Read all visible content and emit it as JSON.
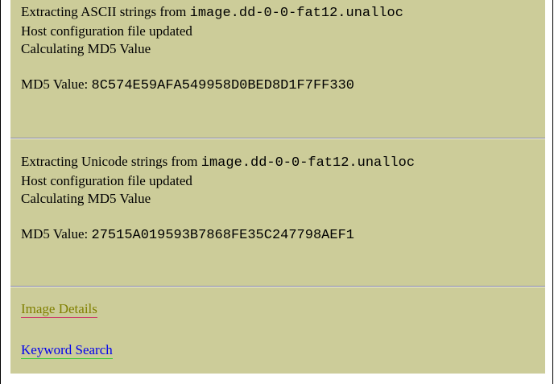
{
  "sections": [
    {
      "extract_prefix": "Extracting ASCII strings from ",
      "filename": "image.dd-0-0-fat12.unalloc",
      "host_msg": "Host configuration file updated",
      "calc_msg": "Calculating MD5 Value",
      "md5_label": "MD5 Value: ",
      "md5_value": "8C574E59AFA549958D0BED8D1F7FF330"
    },
    {
      "extract_prefix": "Extracting Unicode strings from ",
      "filename": "image.dd-0-0-fat12.unalloc",
      "host_msg": "Host configuration file updated",
      "calc_msg": "Calculating MD5 Value",
      "md5_label": "MD5 Value: ",
      "md5_value": "27515A019593B7868FE35C247798AEF1"
    }
  ],
  "links": {
    "image_details": "Image Details",
    "keyword_search": "Keyword Search"
  },
  "colors": {
    "panel_bg": "#cccc99",
    "visited_link": "#808000",
    "link": "#0000ee"
  }
}
